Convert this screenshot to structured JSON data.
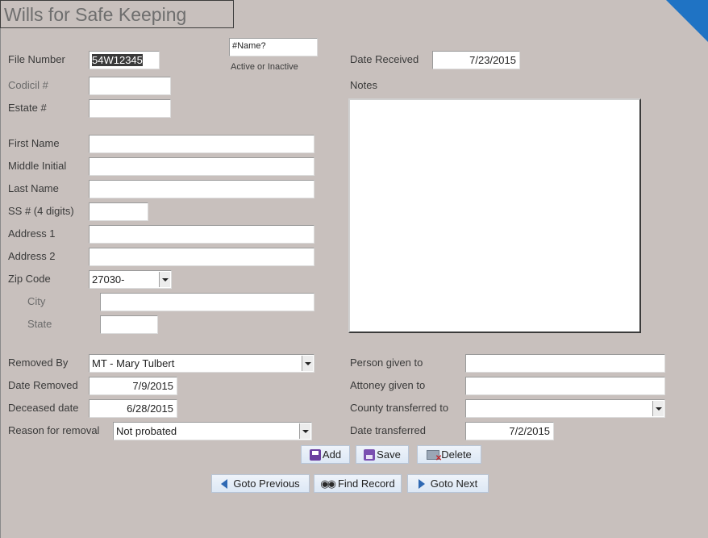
{
  "form": {
    "title": "Wills for Safe Keeping"
  },
  "fields": {
    "file_number": {
      "label": "File Number",
      "value": "54W12345"
    },
    "name_status": {
      "value": "#Name?",
      "caption": "Active or Inactive"
    },
    "date_received": {
      "label": "Date Received",
      "value": "7/23/2015"
    },
    "codicil": {
      "label": "Codicil #",
      "value": ""
    },
    "estate": {
      "label": "Estate #",
      "value": ""
    },
    "notes": {
      "label": "Notes",
      "value": ""
    },
    "first_name": {
      "label": "First Name",
      "value": ""
    },
    "middle_initial": {
      "label": "Middle Initial",
      "value": ""
    },
    "last_name": {
      "label": "Last Name",
      "value": ""
    },
    "ssn": {
      "label": "SS # (4 digits)",
      "value": ""
    },
    "address1": {
      "label": "Address 1",
      "value": ""
    },
    "address2": {
      "label": "Address 2",
      "value": ""
    },
    "zip": {
      "label": "Zip Code",
      "value": "27030-"
    },
    "city": {
      "label": "City",
      "value": ""
    },
    "state": {
      "label": "State",
      "value": ""
    },
    "removed_by": {
      "label": "Removed By",
      "value": "MT - Mary Tulbert"
    },
    "date_removed": {
      "label": "Date Removed",
      "value": "7/9/2015"
    },
    "deceased_date": {
      "label": "Deceased date",
      "value": "6/28/2015"
    },
    "reason": {
      "label": "Reason for removal",
      "value": "Not probated"
    },
    "person_given_to": {
      "label": "Person given to",
      "value": ""
    },
    "attorney_given_to": {
      "label": "Attoney given to",
      "value": ""
    },
    "county_transferred_to": {
      "label": "County transferred to",
      "value": ""
    },
    "date_transferred": {
      "label": "Date transferred",
      "value": "7/2/2015"
    }
  },
  "buttons": {
    "add": "Add",
    "save": "Save",
    "delete": "Delete",
    "previous": "Goto Previous",
    "find": "Find Record",
    "next": "Goto Next"
  },
  "colors": {
    "background": "#c8c0bd",
    "accent_corner": "#1f73c4",
    "button": "#dde8f5"
  }
}
